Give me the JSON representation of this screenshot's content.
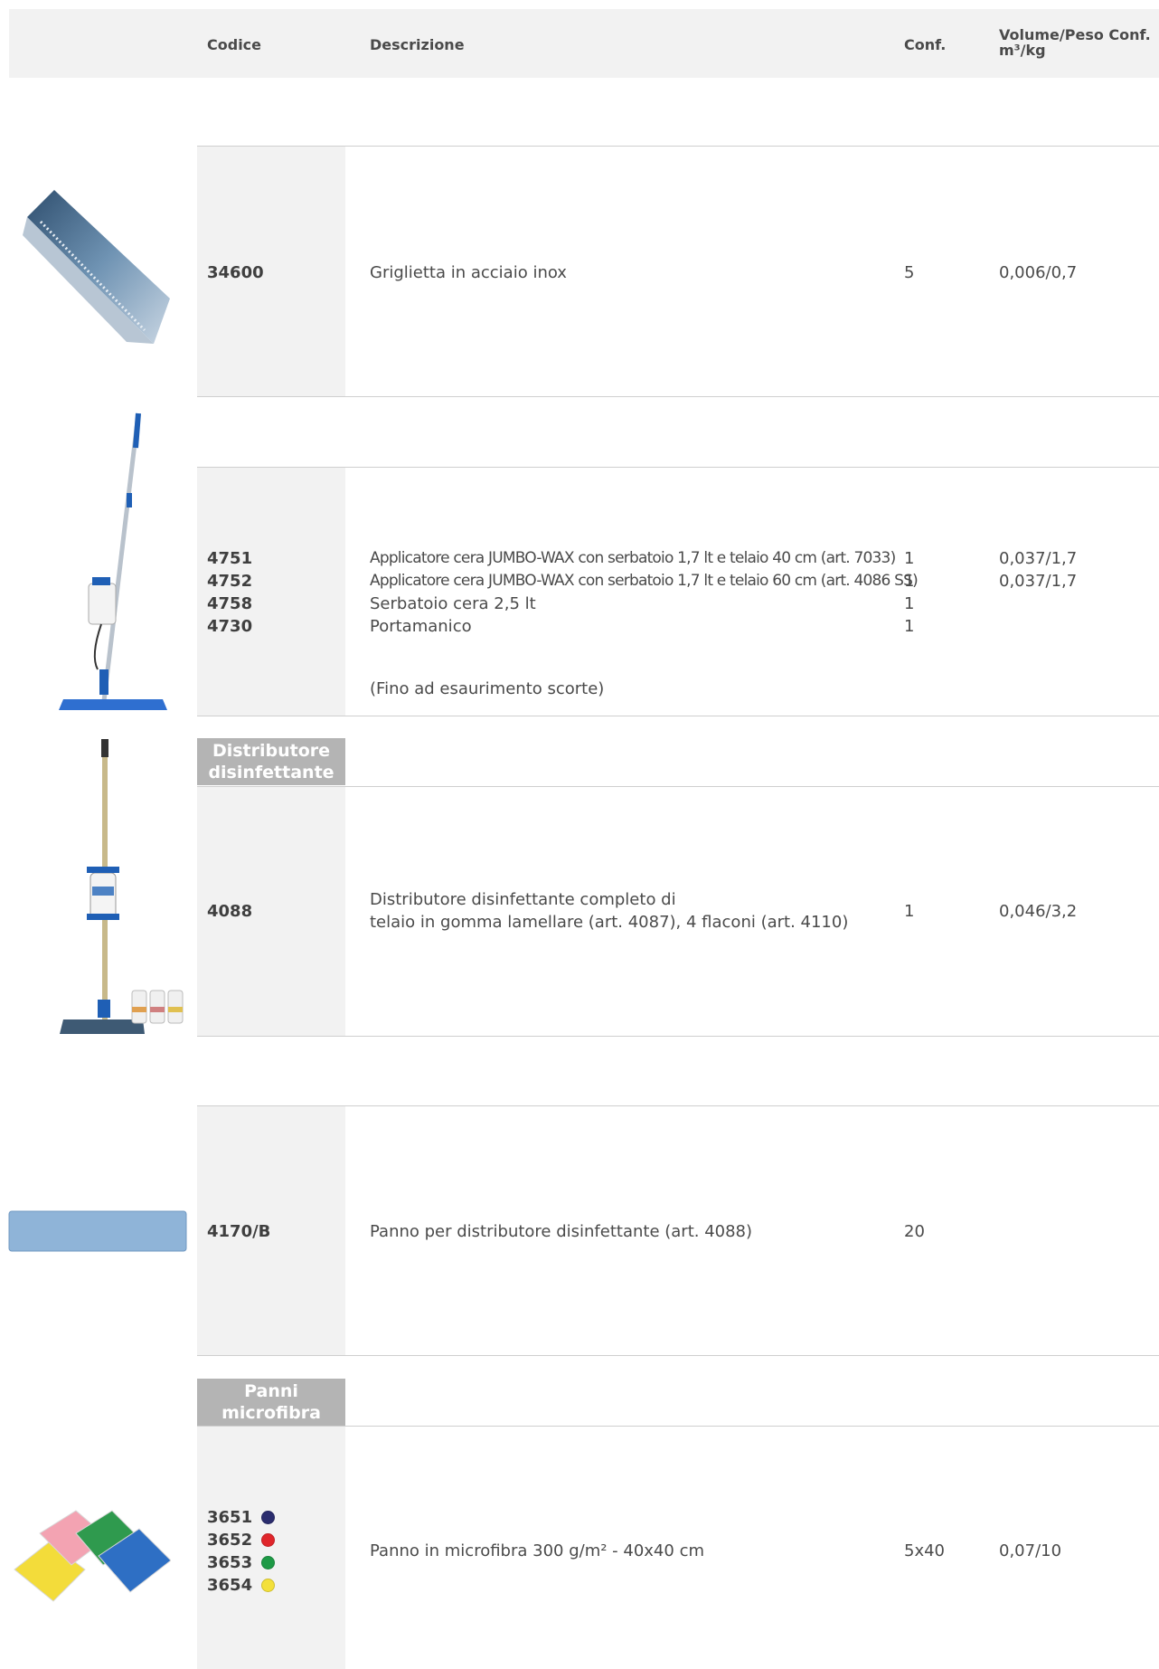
{
  "header": {
    "codice": "Codice",
    "descrizione": "Descrizione",
    "conf": "Conf.",
    "volume_line1": "Volume/Peso Conf.",
    "volume_line2": "m³/kg"
  },
  "products": [
    {
      "image_icon": "steel-grid-image",
      "codes": [
        "34600"
      ],
      "desc": [
        "Griglietta in acciaio inox"
      ],
      "conf": [
        "5"
      ],
      "vol": [
        "0,006/0,7"
      ]
    },
    {
      "image_icon": "wax-applicator-image",
      "codes": [
        "4751",
        "4752",
        "4758",
        "4730"
      ],
      "desc": [
        "Applicatore cera JUMBO-WAX con serbatoio 1,7 lt e telaio 40 cm (art. 7033)",
        "Applicatore cera JUMBO-WAX con serbatoio 1,7 lt e telaio 60 cm (art.  4086 SS)",
        "Serbatoio cera 2,5 lt",
        "Portamanico"
      ],
      "note": "(Fino ad esaurimento scorte)",
      "conf": [
        "1",
        "1",
        "1",
        "1"
      ],
      "vol": [
        "0,037/1,7",
        "0,037/1,7"
      ]
    },
    {
      "tag_line1": "Distributore",
      "tag_line2": "disinfettante",
      "image_icon": "disinfectant-dispenser-image",
      "codes": [
        "4088"
      ],
      "desc": [
        "Distributore disinfettante completo di",
        "telaio in gomma lamellare (art. 4087), 4 flaconi (art. 4110)"
      ],
      "conf": [
        "1"
      ],
      "vol": [
        "0,046/3,2"
      ]
    },
    {
      "image_icon": "mop-cloth-image",
      "codes": [
        "4170/B"
      ],
      "desc": [
        "Panno per distributore disinfettante (art. 4088)"
      ],
      "conf": [
        "20"
      ],
      "vol": []
    },
    {
      "tag_line1": "Panni",
      "tag_line2": "microfibra",
      "image_icon": "microfiber-cloths-image",
      "codes": [
        "3651",
        "3652",
        "3653",
        "3654"
      ],
      "code_colors": [
        "#2b2d6e",
        "#e0262b",
        "#1e9a46",
        "#f3e03a"
      ],
      "desc": [
        "Panno in microfibra 300 g/m² - 40x40 cm"
      ],
      "conf": [
        "5x40"
      ],
      "vol": [
        "0,07/10"
      ]
    }
  ]
}
